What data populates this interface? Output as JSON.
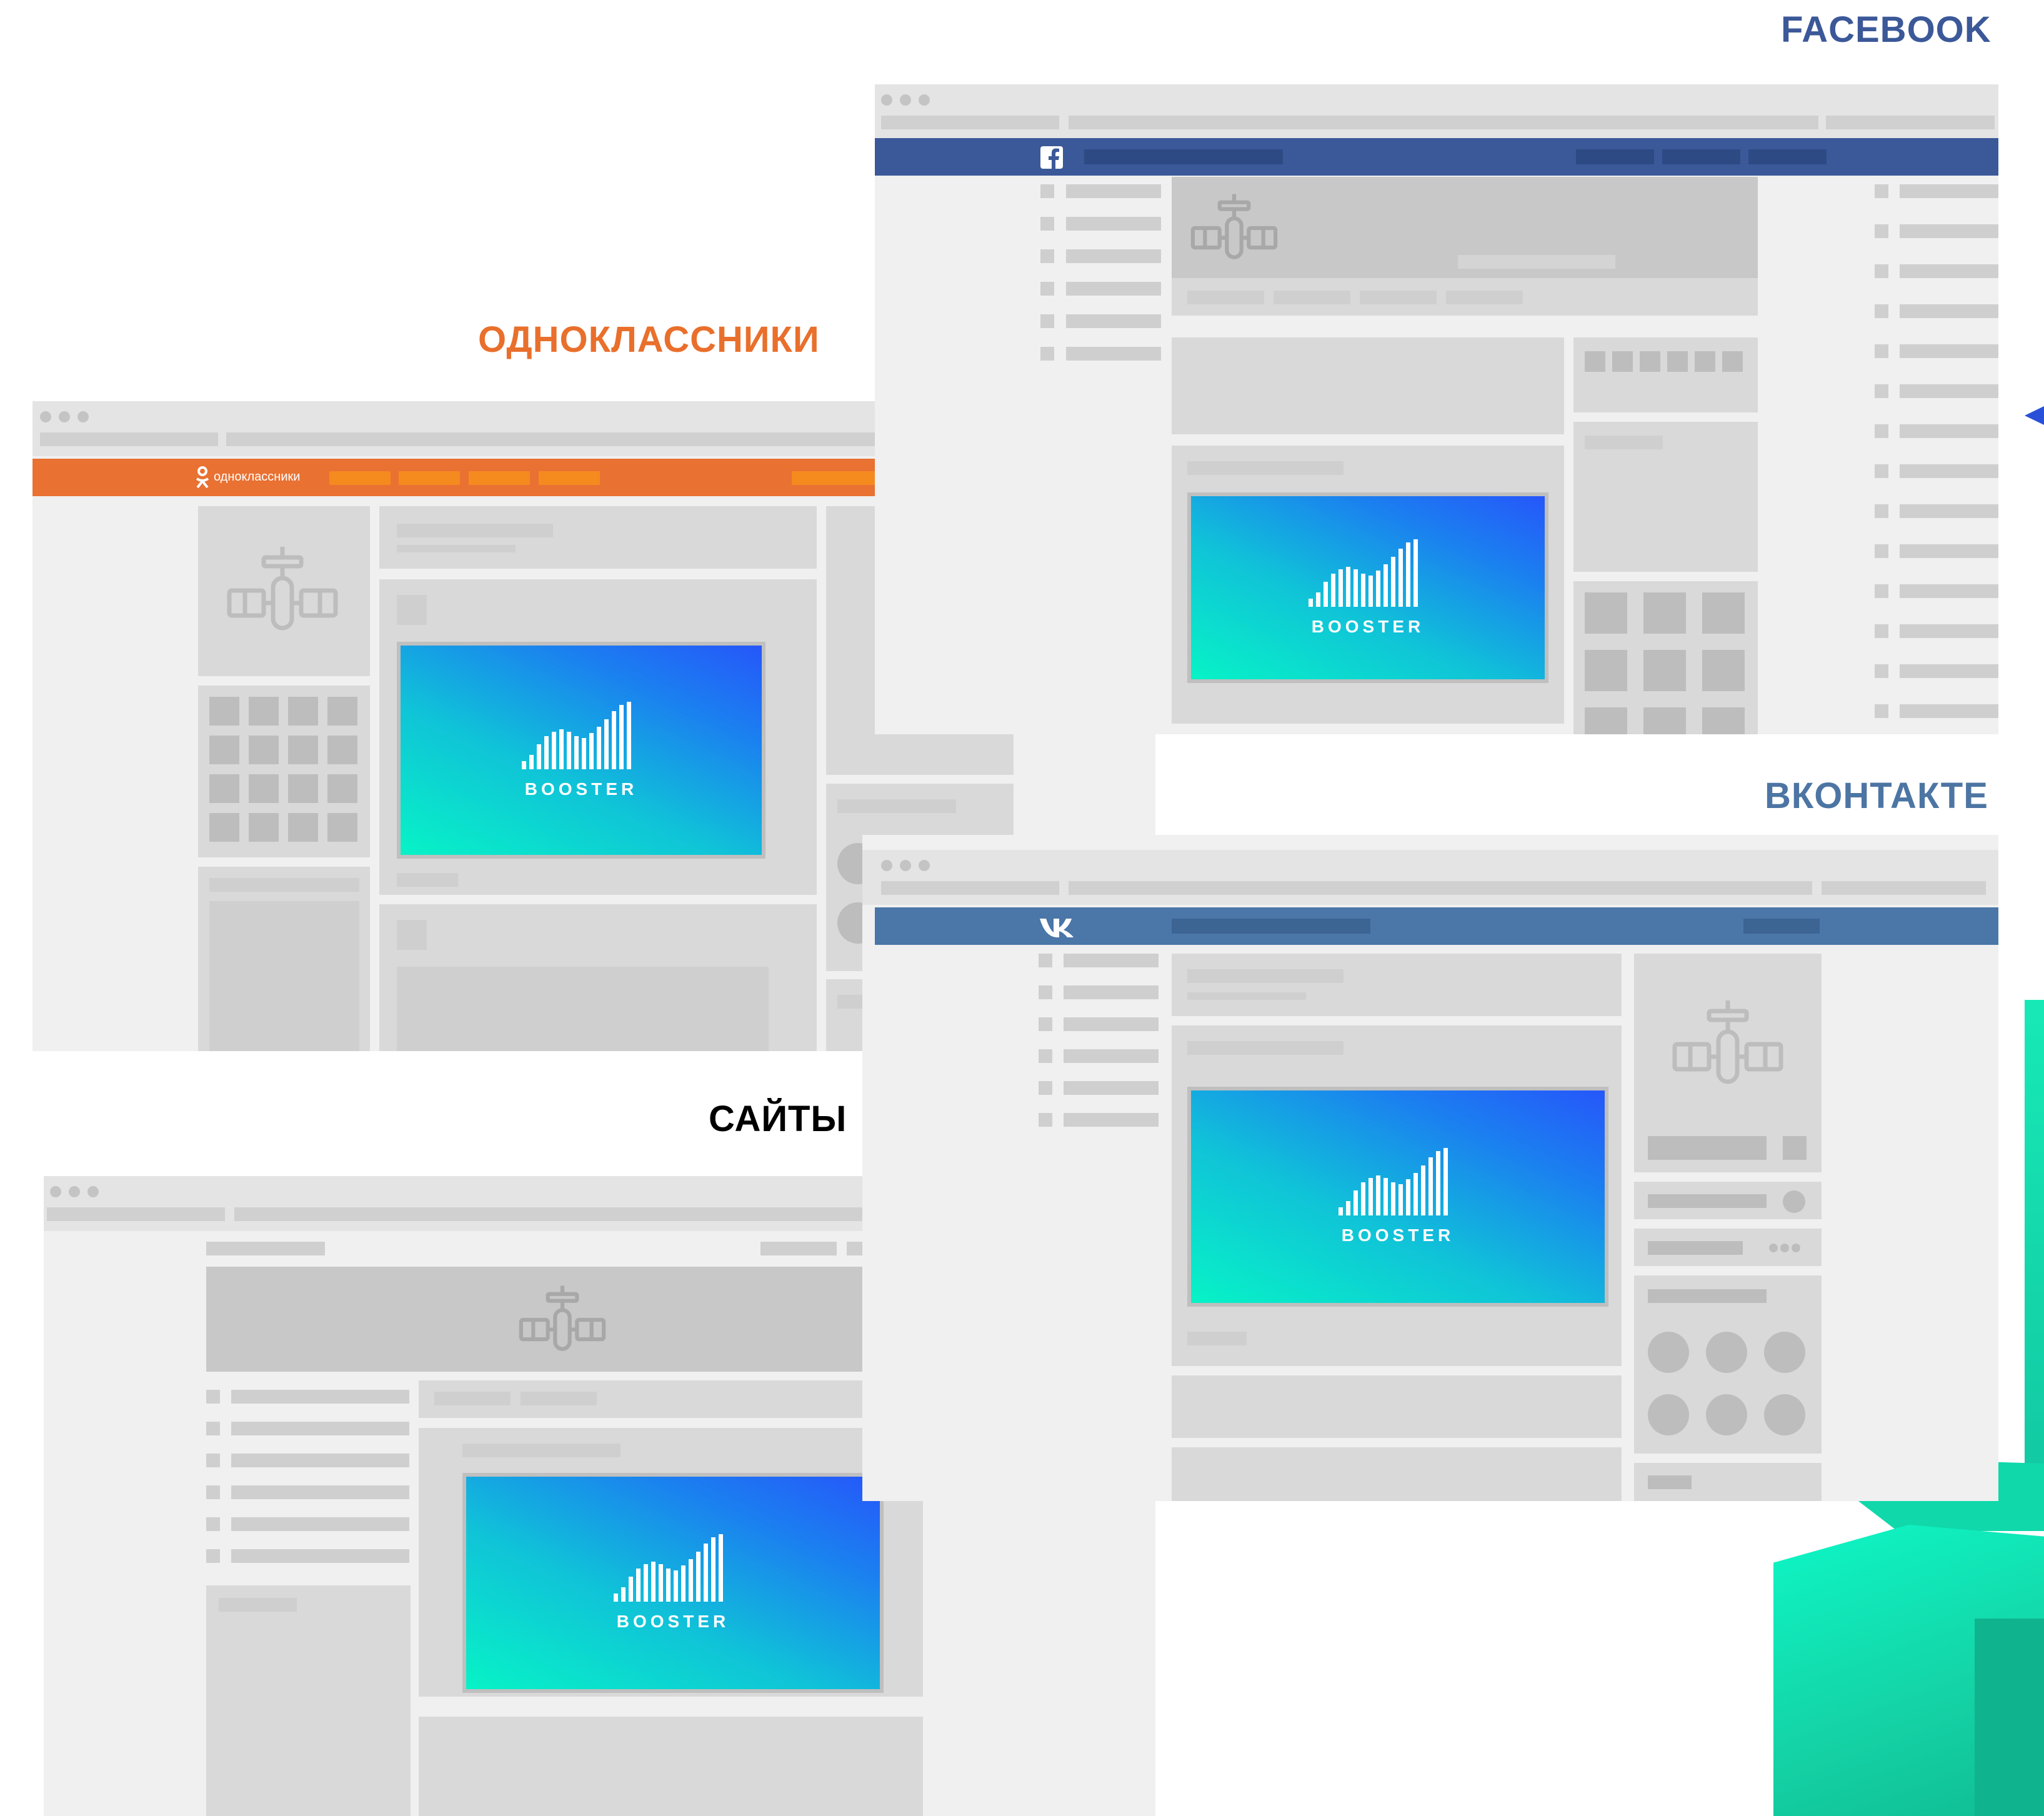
{
  "labels": {
    "facebook": "FACEBOOK",
    "odnoklassniki": "ОДНОКЛАССНИКИ",
    "vkontakte": "ВКОНТАКТЕ",
    "sites": "САЙТЫ"
  },
  "ok_nav_text": "одноклассники",
  "booster_text": "BOOSTER",
  "icons": {
    "facebook_logo": "f",
    "vk_logo": "vk",
    "ok_logo": "ok-person",
    "satellite": "satellite-icon"
  },
  "colors": {
    "facebook_label": "#3b5898",
    "facebook_nav": "#3b5998",
    "ok_label": "#e96f2c",
    "ok_nav": "#e97132",
    "ok_nav_items": "#f58a1f",
    "vk_label": "#4c75a3",
    "vk_nav": "#4a76a8",
    "sites_label": "#000000",
    "promo_gradient_start": "#07f3c6",
    "promo_gradient_end": "#2657fa"
  }
}
